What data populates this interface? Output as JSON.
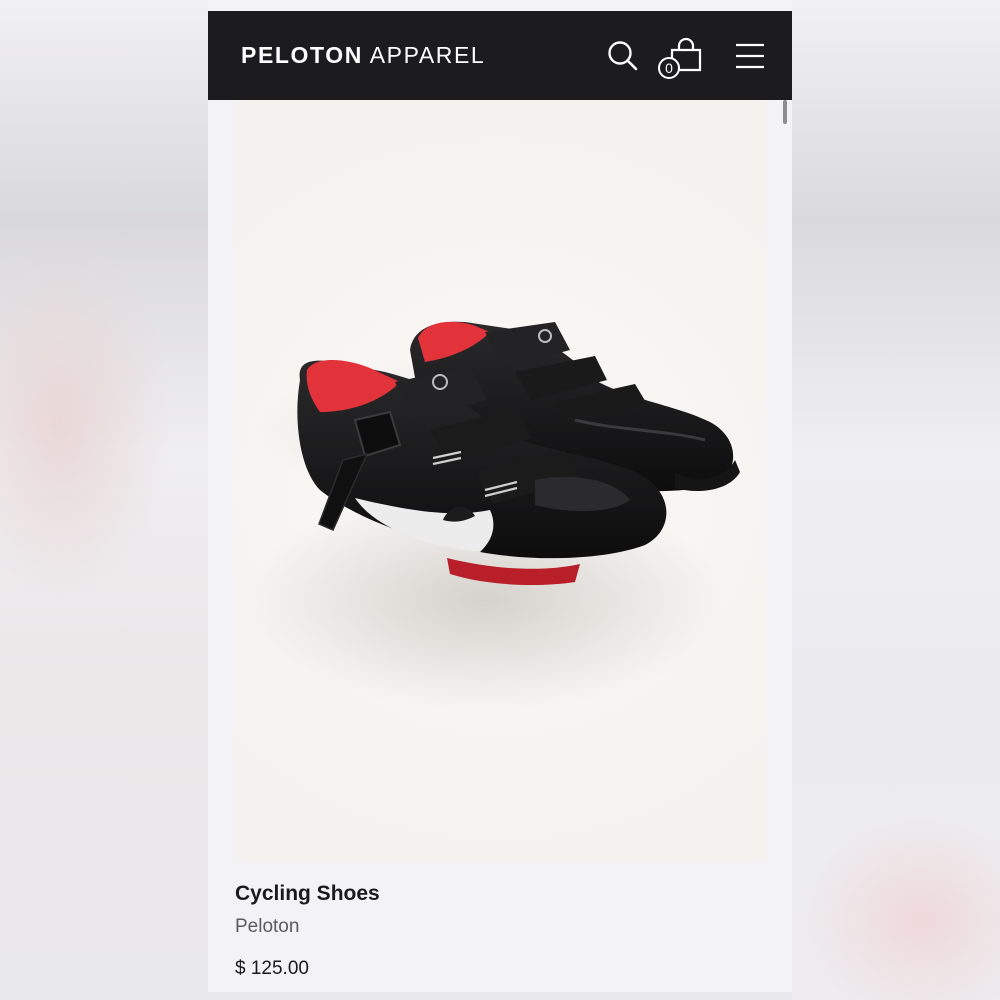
{
  "header": {
    "brand_bold": "PELOTON",
    "brand_light": "APPAREL",
    "cart_count": "0"
  },
  "icons": {
    "search": "search-icon",
    "cart": "shopping-bag-icon",
    "menu": "hamburger-menu-icon"
  },
  "product": {
    "title": "Cycling Shoes",
    "brand": "Peloton",
    "price": "$ 125.00"
  },
  "colors": {
    "header_bg": "#1c1b1d",
    "page_bg": "#f3f2f5",
    "image_bg": "#f7f5f2",
    "shoe_accent": "#e2323a"
  }
}
